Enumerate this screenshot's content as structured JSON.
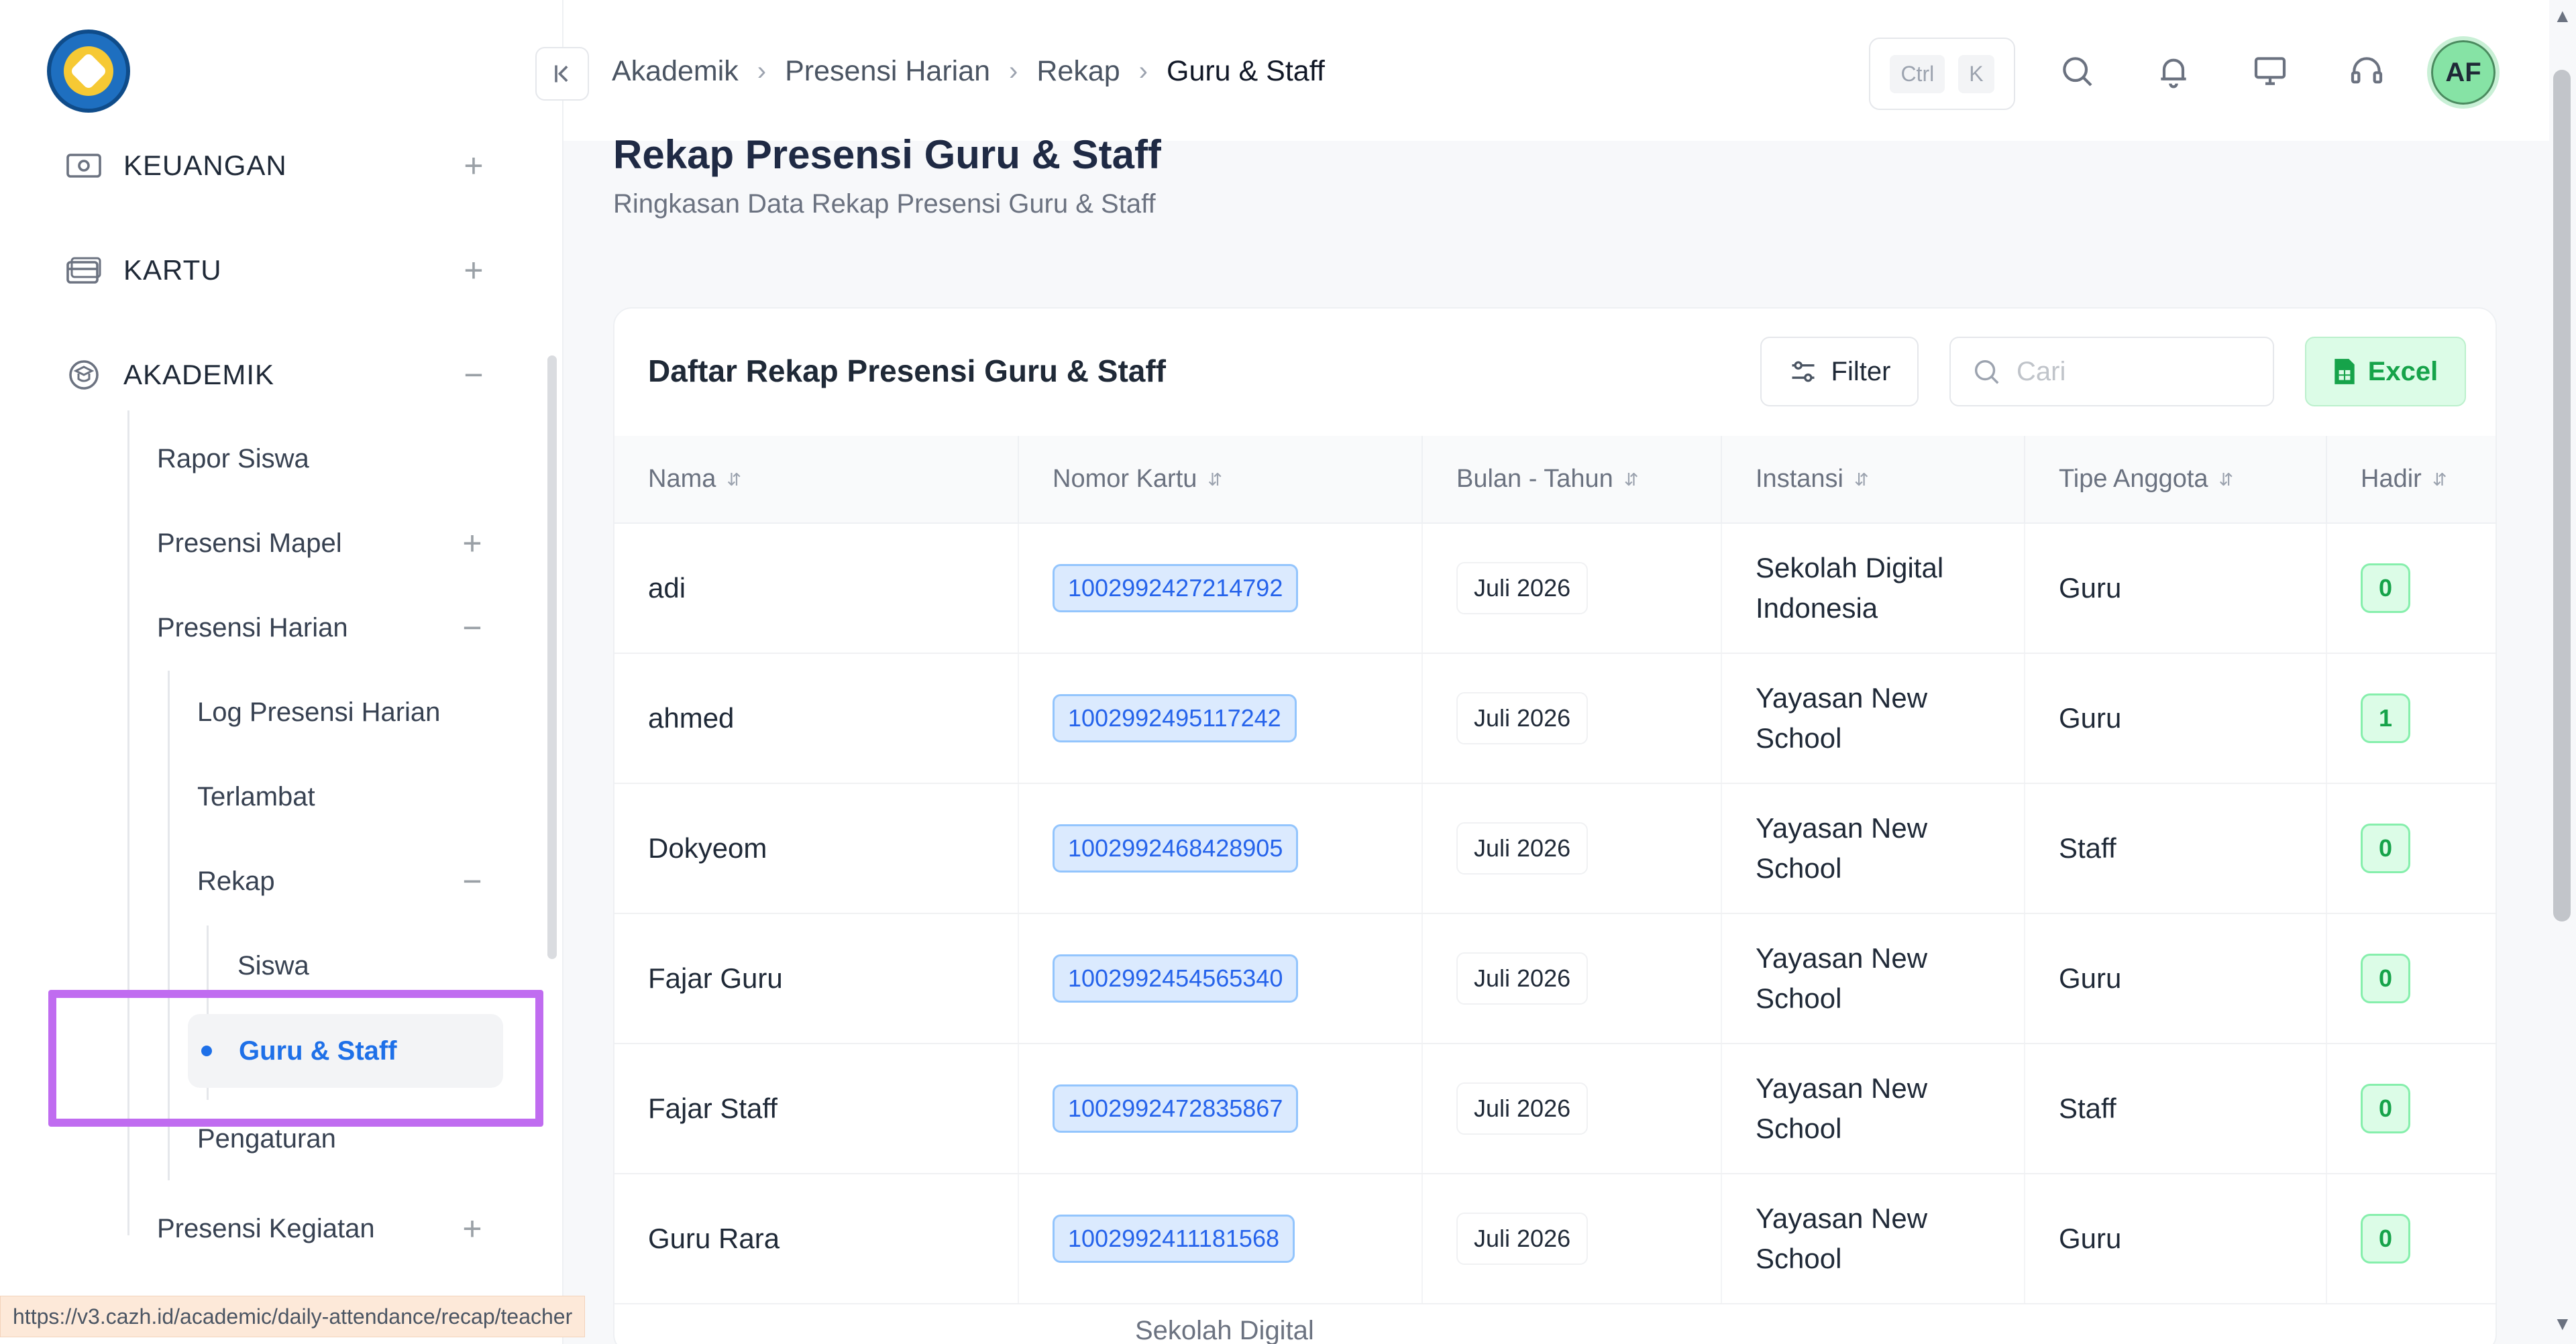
{
  "app": {
    "logo": "tut-wuri-handayani-logo"
  },
  "sidebar": {
    "sections": [
      {
        "label": "KEUANGAN",
        "icon": "wallet-icon",
        "toggle": "+"
      },
      {
        "label": "KARTU",
        "icon": "card-icon",
        "toggle": "+"
      },
      {
        "label": "AKADEMIK",
        "icon": "academic-icon",
        "toggle": "−"
      }
    ],
    "akademik_items": [
      {
        "label": "Rapor Siswa",
        "toggle": ""
      },
      {
        "label": "Presensi Mapel",
        "toggle": "+"
      },
      {
        "label": "Presensi Harian",
        "toggle": "−"
      }
    ],
    "presensi_harian_items": [
      {
        "label": "Log Presensi Harian"
      },
      {
        "label": "Terlambat"
      },
      {
        "label": "Rekap",
        "toggle": "−"
      }
    ],
    "rekap_items": [
      {
        "label": "Siswa"
      },
      {
        "label": "Guru & Staff",
        "active": true
      }
    ],
    "pengaturan_label": "Pengaturan",
    "presensi_kegiatan": {
      "label": "Presensi Kegiatan",
      "toggle": "+"
    }
  },
  "status_url": "https://v3.cazh.id/academic/daily-attendance/recap/teacher",
  "topbar": {
    "breadcrumb": [
      "Akademik",
      "Presensi Harian",
      "Rekap",
      "Guru & Staff"
    ],
    "shortcut": {
      "ctrl": "Ctrl",
      "key": "K"
    },
    "icons": [
      "search-icon",
      "bell-icon",
      "monitor-icon",
      "headset-icon"
    ],
    "avatar_initials": "AF"
  },
  "page": {
    "title": "Rekap Presensi Guru & Staff",
    "subtitle": "Ringkasan Data Rekap Presensi Guru & Staff"
  },
  "card": {
    "title": "Daftar Rekap Presensi Guru & Staff",
    "filter_label": "Filter",
    "search_placeholder": "Cari",
    "excel_label": "Excel"
  },
  "table": {
    "columns": [
      "Nama",
      "Nomor Kartu",
      "Bulan - Tahun",
      "Instansi",
      "Tipe Anggota",
      "Hadir"
    ],
    "rows": [
      {
        "nama": "adi",
        "nomor_kartu": "1002992427214792",
        "bulan_tahun": "Juli 2026",
        "instansi_1": "Sekolah Digital",
        "instansi_2": "Indonesia",
        "tipe": "Guru",
        "hadir": "0"
      },
      {
        "nama": "ahmed",
        "nomor_kartu": "1002992495117242",
        "bulan_tahun": "Juli 2026",
        "instansi_1": "Yayasan New",
        "instansi_2": "School",
        "tipe": "Guru",
        "hadir": "1"
      },
      {
        "nama": "Dokyeom",
        "nomor_kartu": "1002992468428905",
        "bulan_tahun": "Juli 2026",
        "instansi_1": "Yayasan New",
        "instansi_2": "School",
        "tipe": "Staff",
        "hadir": "0"
      },
      {
        "nama": "Fajar Guru",
        "nomor_kartu": "1002992454565340",
        "bulan_tahun": "Juli 2026",
        "instansi_1": "Yayasan New",
        "instansi_2": "School",
        "tipe": "Guru",
        "hadir": "0"
      },
      {
        "nama": "Fajar Staff",
        "nomor_kartu": "1002992472835867",
        "bulan_tahun": "Juli 2026",
        "instansi_1": "Yayasan New",
        "instansi_2": "School",
        "tipe": "Staff",
        "hadir": "0"
      },
      {
        "nama": "Guru Rara",
        "nomor_kartu": "1002992411181568",
        "bulan_tahun": "Juli 2026",
        "instansi_1": "Yayasan New",
        "instansi_2": "School",
        "tipe": "Guru",
        "hadir": "0"
      }
    ],
    "next_row_peek": "Sekolah Digital"
  },
  "colors": {
    "accent": "#1e70e8",
    "highlight": "#c06cf0",
    "excel": "#16a34a",
    "card_badge": "#2563eb"
  }
}
